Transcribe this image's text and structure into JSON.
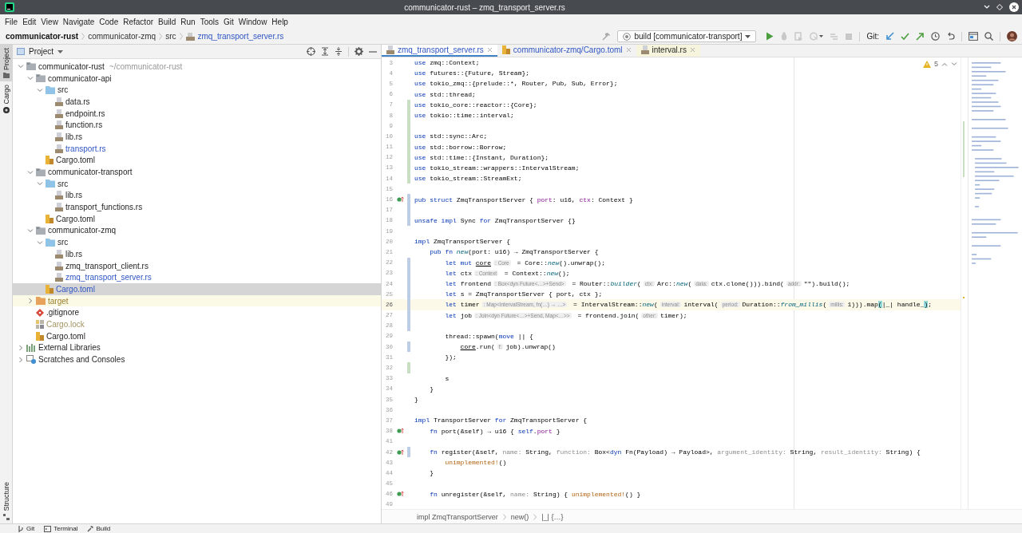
{
  "window": {
    "title": "communicator-rust – zmq_transport_server.rs"
  },
  "menu": [
    "File",
    "Edit",
    "View",
    "Navigate",
    "Code",
    "Refactor",
    "Build",
    "Run",
    "Tools",
    "Git",
    "Window",
    "Help"
  ],
  "navigation": {
    "crumbs": [
      {
        "text": "communicator-rust",
        "kind": "project"
      },
      {
        "text": "communicator-zmq",
        "kind": "folder"
      },
      {
        "text": "src",
        "kind": "folder"
      },
      {
        "text": "zmq_transport_server.rs",
        "kind": "rust"
      }
    ]
  },
  "toolbar": {
    "run_config": "build [communicator-transport]",
    "git_label": "Git:"
  },
  "tool_stripe": {
    "top": [
      {
        "label": "Project",
        "kind": "project",
        "selected": true
      },
      {
        "label": "Cargo",
        "kind": "cargo",
        "selected": false
      }
    ],
    "bottom": [
      {
        "label": "Structure",
        "kind": "structure",
        "selected": false
      }
    ]
  },
  "project": {
    "title": "Project",
    "tree": [
      {
        "name": "communicator-rust",
        "path": "~/communicator-rust",
        "kind": "module",
        "modified": false,
        "ignored": false,
        "selected": false,
        "expanded": true,
        "children": [
          {
            "name": "communicator-api",
            "kind": "module",
            "modified": false,
            "ignored": false,
            "selected": false,
            "expanded": true,
            "children": [
              {
                "name": "src",
                "kind": "source",
                "modified": false,
                "ignored": false,
                "selected": false,
                "expanded": true,
                "children": [
                  {
                    "name": "data.rs",
                    "kind": "rust",
                    "modified": false,
                    "ignored": false,
                    "selected": false
                  },
                  {
                    "name": "endpoint.rs",
                    "kind": "rust",
                    "modified": false,
                    "ignored": false,
                    "selected": false
                  },
                  {
                    "name": "function.rs",
                    "kind": "rust",
                    "modified": false,
                    "ignored": false,
                    "selected": false
                  },
                  {
                    "name": "lib.rs",
                    "kind": "rust",
                    "modified": false,
                    "ignored": false,
                    "selected": false
                  },
                  {
                    "name": "transport.rs",
                    "kind": "rust",
                    "modified": true,
                    "ignored": false,
                    "selected": false
                  }
                ]
              },
              {
                "name": "Cargo.toml",
                "kind": "toml",
                "modified": false,
                "ignored": false,
                "selected": false
              }
            ]
          },
          {
            "name": "communicator-transport",
            "kind": "module",
            "modified": false,
            "ignored": false,
            "selected": false,
            "expanded": true,
            "children": [
              {
                "name": "src",
                "kind": "source",
                "modified": false,
                "ignored": false,
                "selected": false,
                "expanded": true,
                "children": [
                  {
                    "name": "lib.rs",
                    "kind": "rust",
                    "modified": false,
                    "ignored": false,
                    "selected": false
                  },
                  {
                    "name": "transport_functions.rs",
                    "kind": "rust",
                    "modified": false,
                    "ignored": false,
                    "selected": false
                  }
                ]
              },
              {
                "name": "Cargo.toml",
                "kind": "toml",
                "modified": false,
                "ignored": false,
                "selected": false
              }
            ]
          },
          {
            "name": "communicator-zmq",
            "kind": "module",
            "modified": false,
            "ignored": false,
            "selected": false,
            "expanded": true,
            "children": [
              {
                "name": "src",
                "kind": "source",
                "modified": false,
                "ignored": false,
                "selected": false,
                "expanded": true,
                "children": [
                  {
                    "name": "lib.rs",
                    "kind": "rust",
                    "modified": false,
                    "ignored": false,
                    "selected": false
                  },
                  {
                    "name": "zmq_transport_client.rs",
                    "kind": "rust",
                    "modified": false,
                    "ignored": false,
                    "selected": false
                  },
                  {
                    "name": "zmq_transport_server.rs",
                    "kind": "rust",
                    "modified": true,
                    "ignored": false,
                    "selected": false
                  }
                ]
              },
              {
                "name": "Cargo.toml",
                "kind": "toml",
                "modified": true,
                "ignored": false,
                "selected": true
              }
            ]
          },
          {
            "name": "target",
            "kind": "excluded",
            "modified": false,
            "ignored": false,
            "selected": false,
            "expanded": false
          },
          {
            "name": ".gitignore",
            "kind": "git",
            "modified": false,
            "ignored": false,
            "selected": false
          },
          {
            "name": "Cargo.lock",
            "kind": "lock",
            "modified": false,
            "ignored": true,
            "selected": false
          },
          {
            "name": "Cargo.toml",
            "kind": "toml",
            "modified": false,
            "ignored": false,
            "selected": false
          }
        ]
      },
      {
        "name": "External Libraries",
        "kind": "libraries",
        "modified": false,
        "ignored": false,
        "selected": false,
        "expanded": false
      },
      {
        "name": "Scratches and Consoles",
        "kind": "scratches",
        "modified": false,
        "ignored": false,
        "selected": false,
        "expanded": false
      }
    ]
  },
  "editor": {
    "tabs": [
      {
        "label": "zmq_transport_server.rs",
        "kind": "rust",
        "modified": true,
        "external": false,
        "selected": true
      },
      {
        "label": "communicator-zmq/Cargo.toml",
        "kind": "toml",
        "modified": true,
        "external": false,
        "selected": false
      },
      {
        "label": "interval.rs",
        "kind": "rust",
        "modified": false,
        "external": true,
        "selected": false
      }
    ],
    "inspections": {
      "count": "5"
    },
    "lines": [
      {
        "number": "3",
        "highlighted": false,
        "marker": false,
        "tokens": [
          {
            "kind": "keyword",
            "text": "use"
          },
          {
            "kind": "text",
            "text": " zmq::Context;"
          }
        ]
      },
      {
        "number": "4",
        "highlighted": false,
        "marker": false,
        "tokens": [
          {
            "kind": "keyword",
            "text": "use"
          },
          {
            "kind": "text",
            "text": " futures::{Future, Stream};"
          }
        ]
      },
      {
        "number": "5",
        "highlighted": false,
        "marker": false,
        "tokens": [
          {
            "kind": "keyword",
            "text": "use"
          },
          {
            "kind": "text",
            "text": " tokio_zmq::{prelude::*, Router, Pub, Sub, Error};"
          }
        ]
      },
      {
        "number": "6",
        "highlighted": false,
        "marker": false,
        "tokens": [
          {
            "kind": "keyword",
            "text": "use"
          },
          {
            "kind": "text",
            "text": " std::thread;"
          }
        ]
      },
      {
        "number": "7",
        "color": "#c9dfc3",
        "highlighted": false,
        "marker": false,
        "tokens": [
          {
            "kind": "keyword",
            "text": "use"
          },
          {
            "kind": "text",
            "text": " tokio_core::reactor::{Core};"
          }
        ]
      },
      {
        "number": "8",
        "color": "#c9dfc3",
        "highlighted": false,
        "marker": false,
        "tokens": [
          {
            "kind": "keyword",
            "text": "use"
          },
          {
            "kind": "text",
            "text": " tokio::time::interval;"
          }
        ]
      },
      {
        "number": "9",
        "color": "#c9dfc3",
        "highlighted": false,
        "marker": false
      },
      {
        "number": "10",
        "color": "#c9dfc3",
        "highlighted": false,
        "marker": false,
        "tokens": [
          {
            "kind": "keyword",
            "text": "use"
          },
          {
            "kind": "text",
            "text": " std::sync::Arc;"
          }
        ]
      },
      {
        "number": "11",
        "color": "#c9dfc3",
        "highlighted": false,
        "marker": false,
        "tokens": [
          {
            "kind": "keyword",
            "text": "use"
          },
          {
            "kind": "text",
            "text": " std::borrow::Borrow;"
          }
        ]
      },
      {
        "number": "12",
        "color": "#c9dfc3",
        "highlighted": false,
        "marker": false,
        "tokens": [
          {
            "kind": "keyword",
            "text": "use"
          },
          {
            "kind": "text",
            "text": " std::time::{Instant, Duration};"
          }
        ]
      },
      {
        "number": "13",
        "color": "#c9dfc3",
        "highlighted": false,
        "marker": false,
        "tokens": [
          {
            "kind": "keyword",
            "text": "use"
          },
          {
            "kind": "text",
            "text": " tokio_stream::wrappers::IntervalStream;"
          }
        ]
      },
      {
        "number": "14",
        "color": "#c9dfc3",
        "highlighted": false,
        "marker": false,
        "tokens": [
          {
            "kind": "keyword",
            "text": "use"
          },
          {
            "kind": "text",
            "text": " tokio_stream::StreamExt;"
          }
        ]
      },
      {
        "number": "15",
        "highlighted": false,
        "marker": false
      },
      {
        "number": "16",
        "color": "#bccde4",
        "highlighted": false,
        "marker": true,
        "tokens": [
          {
            "kind": "keyword",
            "text": "pub struct"
          },
          {
            "kind": "text",
            "text": " ZmqTransportServer { "
          },
          {
            "kind": "field",
            "text": "port"
          },
          {
            "kind": "text",
            "text": ": u16, "
          },
          {
            "kind": "field",
            "text": "ctx"
          },
          {
            "kind": "text",
            "text": ": Context }"
          }
        ]
      },
      {
        "number": "17",
        "color": "#bccde4",
        "highlighted": false,
        "marker": false
      },
      {
        "number": "18",
        "color": "#bccde4",
        "highlighted": false,
        "marker": false,
        "tokens": [
          {
            "kind": "keyword",
            "text": "unsafe impl"
          },
          {
            "kind": "text",
            "text": " Sync "
          },
          {
            "kind": "keyword",
            "text": "for"
          },
          {
            "kind": "text",
            "text": " ZmqTransportServer {}"
          }
        ]
      },
      {
        "number": "19",
        "highlighted": false,
        "marker": false
      },
      {
        "number": "20",
        "highlighted": false,
        "marker": false,
        "tokens": [
          {
            "kind": "keyword",
            "text": "impl"
          },
          {
            "kind": "text",
            "text": " ZmqTransportServer {"
          }
        ]
      },
      {
        "number": "21",
        "highlighted": false,
        "marker": false,
        "tokens": [
          {
            "kind": "keyword",
            "text": "    pub fn "
          },
          {
            "kind": "call",
            "text": "new"
          },
          {
            "kind": "text",
            "text": "(port: u16) → ZmqTransportServer {"
          }
        ]
      },
      {
        "number": "22",
        "color": "#bccde4",
        "highlighted": false,
        "marker": false,
        "tokens": [
          {
            "kind": "keyword",
            "text": "        let mut "
          },
          {
            "kind": "underlined",
            "text": "core"
          },
          {
            "kind": "hint",
            "text": ": Core"
          },
          {
            "kind": "text",
            "text": " = Core::"
          },
          {
            "kind": "call",
            "text": "new"
          },
          {
            "kind": "text",
            "text": "().unwrap();"
          }
        ]
      },
      {
        "number": "23",
        "color": "#bccde4",
        "highlighted": false,
        "marker": false,
        "tokens": [
          {
            "kind": "keyword",
            "text": "        let"
          },
          {
            "kind": "text",
            "text": " ctx"
          },
          {
            "kind": "hint",
            "text": ": Context"
          },
          {
            "kind": "text",
            "text": " = Context::"
          },
          {
            "kind": "call",
            "text": "new"
          },
          {
            "kind": "text",
            "text": "();"
          }
        ]
      },
      {
        "number": "24",
        "color": "#bccde4",
        "highlighted": false,
        "marker": false,
        "tokens": [
          {
            "kind": "keyword",
            "text": "        let"
          },
          {
            "kind": "text",
            "text": " frontend"
          },
          {
            "kind": "hint",
            "text": ": Box<dyn Future<…>+Send>"
          },
          {
            "kind": "text",
            "text": " = Router::"
          },
          {
            "kind": "call",
            "text": "builder"
          },
          {
            "kind": "text",
            "text": "("
          },
          {
            "kind": "hint",
            "text": "ctx:"
          },
          {
            "kind": "text",
            "text": "Arc::"
          },
          {
            "kind": "call",
            "text": "new"
          },
          {
            "kind": "text",
            "text": "("
          },
          {
            "kind": "hint",
            "text": "data:"
          },
          {
            "kind": "text",
            "text": "ctx.clone())).bind("
          },
          {
            "kind": "hint",
            "text": "addr:"
          },
          {
            "kind": "text",
            "text": "\"\").build();"
          }
        ]
      },
      {
        "number": "25",
        "color": "#bccde4",
        "highlighted": false,
        "marker": false,
        "tokens": [
          {
            "kind": "keyword",
            "text": "        let"
          },
          {
            "kind": "text",
            "text": " s = ZmqTransportServer { port, ctx };"
          }
        ]
      },
      {
        "number": "26",
        "color": "#bccde4",
        "highlighted": true,
        "marker": false,
        "tokens": [
          {
            "kind": "keyword",
            "text": "        let"
          },
          {
            "kind": "text",
            "text": " timer"
          },
          {
            "kind": "hint",
            "text": ": Map<IntervalStream, fn(…) → …>"
          },
          {
            "kind": "text",
            "text": " = IntervalStream::"
          },
          {
            "kind": "call",
            "text": "new"
          },
          {
            "kind": "text",
            "text": "("
          },
          {
            "kind": "hint",
            "text": "interval:"
          },
          {
            "kind": "text",
            "text": "interval("
          },
          {
            "kind": "hint",
            "text": "period:"
          },
          {
            "kind": "text",
            "text": "Duration::"
          },
          {
            "kind": "call",
            "text": "from_millis"
          },
          {
            "kind": "text",
            "text": "("
          },
          {
            "kind": "hint",
            "text": "millis:"
          },
          {
            "kind": "text",
            "text": "1))).map"
          },
          {
            "kind": "brace",
            "text": "("
          },
          {
            "kind": "text",
            "text": "|_| handle_"
          },
          {
            "kind": "brace",
            "text": ")"
          },
          {
            "kind": "text",
            "text": ";"
          }
        ]
      },
      {
        "number": "27",
        "color": "#bccde4",
        "highlighted": false,
        "marker": false,
        "tokens": [
          {
            "kind": "keyword",
            "text": "        let"
          },
          {
            "kind": "text",
            "text": " job"
          },
          {
            "kind": "hint",
            "text": ": Join<dyn Future<…>+Send, Map<…>>"
          },
          {
            "kind": "text",
            "text": " = frontend.join("
          },
          {
            "kind": "hint",
            "text": "other:"
          },
          {
            "kind": "text",
            "text": "timer);"
          }
        ]
      },
      {
        "number": "28",
        "color": "#bccde4",
        "highlighted": false,
        "marker": false
      },
      {
        "number": "29",
        "highlighted": false,
        "marker": false,
        "tokens": [
          {
            "kind": "text",
            "text": "        thread::spawn("
          },
          {
            "kind": "keyword",
            "text": "move"
          },
          {
            "kind": "text",
            "text": " || {"
          }
        ]
      },
      {
        "number": "30",
        "color": "#bccde4",
        "highlighted": false,
        "marker": false,
        "tokens": [
          {
            "kind": "underlined",
            "text": "            core"
          },
          {
            "kind": "text",
            "text": ".run("
          },
          {
            "kind": "hint",
            "text": "f:"
          },
          {
            "kind": "text",
            "text": "job).unwrap()"
          }
        ]
      },
      {
        "number": "31",
        "highlighted": false,
        "marker": false,
        "tokens": [
          {
            "kind": "text",
            "text": "        });"
          }
        ]
      },
      {
        "number": "32",
        "color": "#c9dfc3",
        "highlighted": false,
        "marker": false
      },
      {
        "number": "33",
        "highlighted": false,
        "marker": false,
        "tokens": [
          {
            "kind": "text",
            "text": "        s"
          }
        ]
      },
      {
        "number": "34",
        "highlighted": false,
        "marker": false,
        "tokens": [
          {
            "kind": "text",
            "text": "    }"
          }
        ]
      },
      {
        "number": "35",
        "highlighted": false,
        "marker": false,
        "tokens": [
          {
            "kind": "text",
            "text": "}"
          }
        ]
      },
      {
        "number": "36",
        "highlighted": false,
        "marker": false
      },
      {
        "number": "37",
        "highlighted": false,
        "marker": false,
        "tokens": [
          {
            "kind": "keyword",
            "text": "impl"
          },
          {
            "kind": "text",
            "text": " TransportServer "
          },
          {
            "kind": "keyword",
            "text": "for"
          },
          {
            "kind": "text",
            "text": " ZmqTransportServer {"
          }
        ]
      },
      {
        "number": "38",
        "highlighted": false,
        "marker": true,
        "tokens": [
          {
            "kind": "keyword",
            "text": "    fn"
          },
          {
            "kind": "text",
            "text": " port(&self) → u16 { "
          },
          {
            "kind": "keyword",
            "text": "self"
          },
          {
            "kind": "text",
            "text": "."
          },
          {
            "kind": "field",
            "text": "port"
          },
          {
            "kind": "text",
            "text": " }"
          }
        ]
      },
      {
        "number": "41",
        "highlighted": false,
        "marker": false
      },
      {
        "number": "42",
        "color": "#bccde4",
        "highlighted": false,
        "marker": true,
        "tokens": [
          {
            "kind": "keyword",
            "text": "    fn"
          },
          {
            "kind": "text",
            "text": " register(&self, "
          },
          {
            "kind": "param",
            "text": "name:"
          },
          {
            "kind": "text",
            "text": " String, "
          },
          {
            "kind": "param",
            "text": "function:"
          },
          {
            "kind": "text",
            "text": " Box<"
          },
          {
            "kind": "keyword",
            "text": "dyn"
          },
          {
            "kind": "text",
            "text": " Fn(Payload) → Payload>, "
          },
          {
            "kind": "param",
            "text": "argument_identity:"
          },
          {
            "kind": "text",
            "text": " String, "
          },
          {
            "kind": "param",
            "text": "result_identity:"
          },
          {
            "kind": "text",
            "text": " String) {"
          }
        ]
      },
      {
        "number": "43",
        "highlighted": false,
        "marker": false,
        "tokens": [
          {
            "kind": "macro",
            "text": "        unimplemented!"
          },
          {
            "kind": "text",
            "text": "()"
          }
        ]
      },
      {
        "number": "44",
        "highlighted": false,
        "marker": false,
        "tokens": [
          {
            "kind": "text",
            "text": "    }"
          }
        ]
      },
      {
        "number": "45",
        "highlighted": false,
        "marker": false
      },
      {
        "number": "46",
        "highlighted": false,
        "marker": true,
        "tokens": [
          {
            "kind": "keyword",
            "text": "    fn"
          },
          {
            "kind": "text",
            "text": " unregister(&self, "
          },
          {
            "kind": "param",
            "text": "name:"
          },
          {
            "kind": "text",
            "text": " String) { "
          },
          {
            "kind": "macro",
            "text": "unimplemented!"
          },
          {
            "kind": "text",
            "text": "() }"
          }
        ]
      },
      {
        "number": "49",
        "highlighted": false,
        "marker": false
      }
    ],
    "breadcrumb": [
      "impl ZmqTransportServer",
      "new()",
      "|_| {…}"
    ]
  },
  "status_bar": {
    "tabs": [
      {
        "label": "Git",
        "kind": "git"
      },
      {
        "label": "Terminal",
        "kind": "terminal"
      },
      {
        "label": "Build",
        "kind": "build"
      }
    ]
  }
}
